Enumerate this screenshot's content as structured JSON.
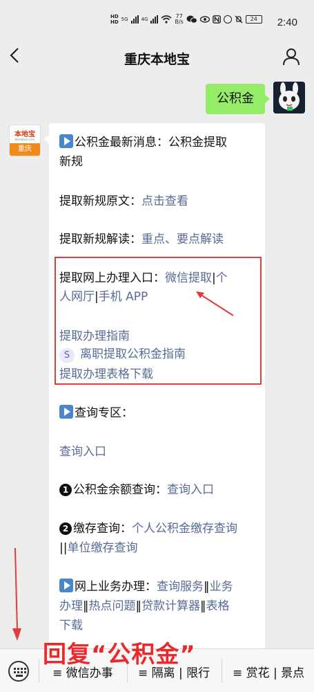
{
  "status_bar": {
    "sim1": "HD",
    "sim2": "HD",
    "net1": "5G",
    "net2": "4G",
    "speed_value": "77",
    "speed_unit": "B/s",
    "battery": "24",
    "time": "2:40"
  },
  "nav": {
    "title": "重庆本地宝",
    "back_glyph": "‹"
  },
  "outgoing": {
    "text": "公积金"
  },
  "bot_avatar": {
    "brand": "本地宝",
    "site": "Bendibao.com",
    "city": "重庆"
  },
  "message": {
    "news_prefix": "公积金最新消息：",
    "news_link_1": "公积金提取",
    "news_link_2": "新规",
    "rule_text_label": "提取新规原文：",
    "rule_text_link": "点击查看",
    "rule_interpret_label": "提取新规解读：",
    "rule_interpret_link": "重点、要点解读",
    "online_label": "提取网上办理入口：",
    "online_link_wechat": "微信提取",
    "sep": "|",
    "online_link_personal_a": "个",
    "online_link_personal_b": "人网厅",
    "online_link_app": "手机 APP",
    "guide_link": "提取办理指南",
    "resign_link": "离职提取公积金指南",
    "form_link": "提取办理表格下载",
    "query_zone": "查询专区：",
    "query_entry": "查询入口",
    "balance_num": "1",
    "balance_label": "公积金余额查询：",
    "balance_link": "查询入口",
    "deposit_num": "2",
    "deposit_label": "缴存查询：",
    "deposit_link_1": "个人公积金缴存查询",
    "deposit_sep": "||",
    "deposit_link_2": "单位缴存查询",
    "biz_label": "网上业务办理：",
    "biz_link_1": "查询服务",
    "biz_sep": "‖",
    "biz_link_2a": "业务",
    "biz_link_2b": "办理",
    "biz_link_3": "热点问题",
    "biz_link_4": "贷款计算器",
    "biz_link_5a": "表格",
    "biz_link_5b": "下载"
  },
  "overlay": {
    "text": "回复“公积金”"
  },
  "bottom_menu": {
    "items": [
      "≡ 微信办事",
      "≡ 隔离 | 限行",
      "≡ 赏花 | 景点"
    ]
  },
  "colors": {
    "link": "#576b95",
    "bubble_out": "#95ec69",
    "highlight": "#e33a3a"
  }
}
